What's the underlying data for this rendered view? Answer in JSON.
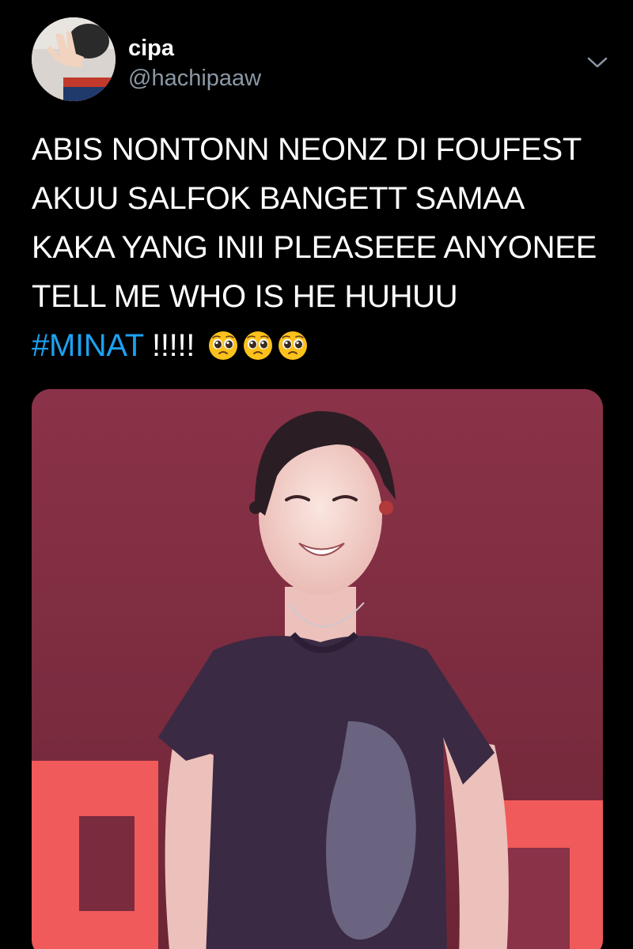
{
  "tweet": {
    "display_name": "cipa",
    "handle": "@hachipaaw",
    "menu_icon": "chevron-down-icon",
    "text_lines": [
      "ABIS NONTONN NEONZ DI FOUFEST",
      "AKUU SALFOK BANGETT SAMAA",
      "KAKA YANG INII PLEASEEE ANYONEE",
      "TELL ME WHO IS HE HUHUU"
    ],
    "hashtag": "#MINAT",
    "exclaim": " !!!!!",
    "emojis": [
      "pleading-face-emoji",
      "pleading-face-emoji",
      "pleading-face-emoji"
    ],
    "colors": {
      "background": "#000000",
      "text": "#ffffff",
      "handle": "#8b98a5",
      "link": "#1da1f2"
    }
  }
}
